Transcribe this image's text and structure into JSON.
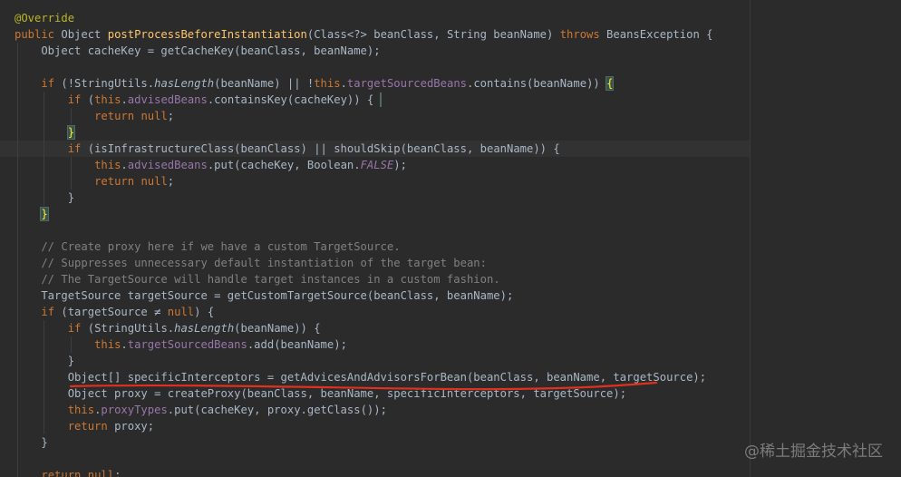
{
  "editor": {
    "lines": [
      "@Override",
      "public Object postProcessBeforeInstantiation(Class<?> beanClass, String beanName) throws BeansException {",
      "    Object cacheKey = getCacheKey(beanClass, beanName);",
      "",
      "    if (!StringUtils.hasLength(beanName) || !this.targetSourcedBeans.contains(beanName)) {",
      "        if (this.advisedBeans.containsKey(cacheKey)) {",
      "            return null;",
      "        }",
      "        if (isInfrastructureClass(beanClass) || shouldSkip(beanClass, beanName)) {",
      "            this.advisedBeans.put(cacheKey, Boolean.FALSE);",
      "            return null;",
      "        }",
      "    }",
      "",
      "    // Create proxy here if we have a custom TargetSource.",
      "    // Suppresses unnecessary default instantiation of the target bean:",
      "    // The TargetSource will handle target instances in a custom fashion.",
      "    TargetSource targetSource = getCustomTargetSource(beanClass, beanName);",
      "    if (targetSource ≠ null) {",
      "        if (StringUtils.hasLength(beanName)) {",
      "            this.targetSourcedBeans.add(beanName);",
      "        }",
      "        Object[] specificInterceptors = getAdvicesAndAdvisorsForBean(beanClass, beanName, targetSource);",
      "        Object proxy = createProxy(beanClass, beanName, specificInterceptors, targetSource);",
      "        this.proxyTypes.put(cacheKey, proxy.getClass());",
      "        return proxy;",
      "    }",
      "",
      "    return null;"
    ],
    "highlighted_line": 8,
    "underlined_line": 23,
    "colors": {
      "background": "#2b2b2b",
      "keyword": "#cc7832",
      "method": "#ffc66d",
      "field": "#9876aa",
      "comment": "#808080",
      "annotation": "#bbb529",
      "text": "#a9b7c6",
      "underline": "#e0301e"
    }
  },
  "watermark": "@稀土掘金技术社区"
}
